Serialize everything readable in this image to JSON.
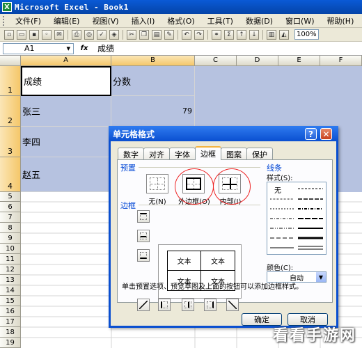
{
  "window": {
    "title": "Microsoft Excel - Book1",
    "app_icon": "X"
  },
  "menu": [
    "文件(F)",
    "编辑(E)",
    "视图(V)",
    "插入(I)",
    "格式(O)",
    "工具(T)",
    "数据(D)",
    "窗口(W)",
    "帮助(H)"
  ],
  "toolbar": {
    "zoom": "100%"
  },
  "formula_bar": {
    "name_box": "A1",
    "fx": "fx",
    "content": "成绩"
  },
  "columns": [
    "A",
    "B",
    "C",
    "D",
    "E",
    "F"
  ],
  "rows": [
    "1",
    "2",
    "3",
    "4",
    "5",
    "6",
    "7",
    "8",
    "9",
    "10",
    "11",
    "12",
    "13",
    "14",
    "15",
    "16",
    "17",
    "18",
    "19"
  ],
  "cells": {
    "a1": "成绩",
    "b1": "分数",
    "a2": "张三",
    "b2": "79",
    "a3": "李四",
    "a4": "赵五"
  },
  "dialog": {
    "title": "单元格格式",
    "help": "?",
    "close": "✕",
    "tabs": [
      "数字",
      "对齐",
      "字体",
      "边框",
      "图案",
      "保护"
    ],
    "active_tab": "边框",
    "preset_section": "预置",
    "presets": [
      "无(N)",
      "外边框(O)",
      "内部(I)"
    ],
    "border_section": "边框",
    "preview_text": [
      "文本",
      "文本",
      "文本",
      "文本"
    ],
    "line_section": "线条",
    "style_label": "样式(S):",
    "none_style": "无",
    "color_label": "颜色(C):",
    "color_value": "自动",
    "hint": "单击预置选项、预览草图及上面的按钮可以添加边框样式。",
    "ok": "确定",
    "cancel": "取消"
  },
  "watermark": "看看手游网"
}
